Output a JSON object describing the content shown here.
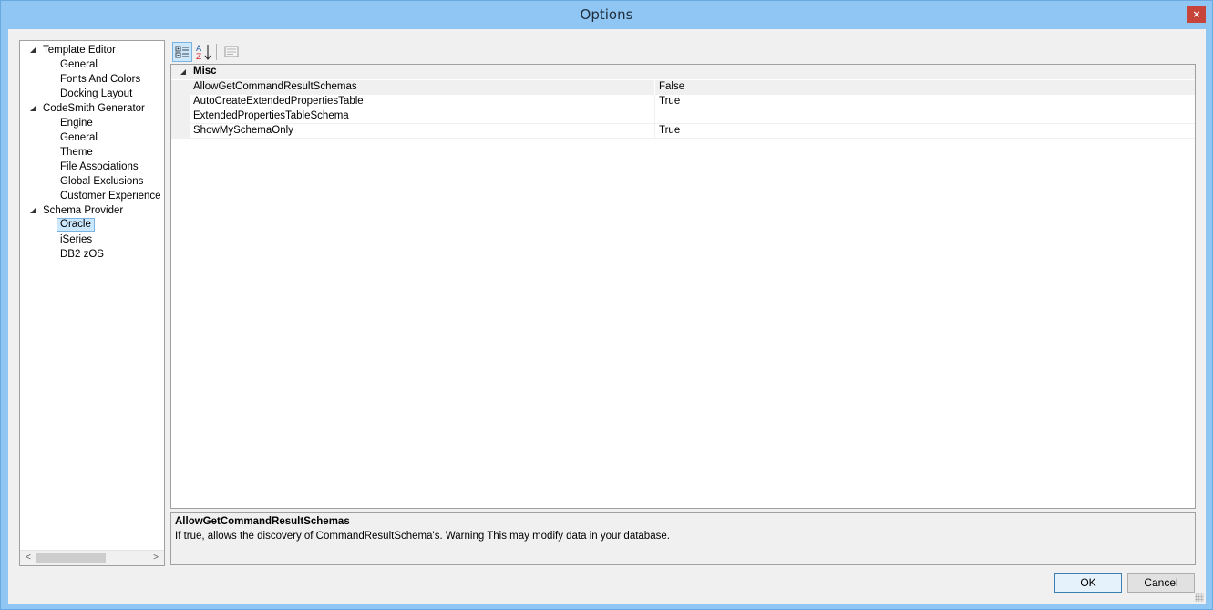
{
  "window": {
    "title": "Options",
    "close_glyph": "×"
  },
  "tree": {
    "items": [
      {
        "label": "Template Editor",
        "level": 0
      },
      {
        "label": "General",
        "level": 1
      },
      {
        "label": "Fonts And Colors",
        "level": 1
      },
      {
        "label": "Docking Layout",
        "level": 1
      },
      {
        "label": "CodeSmith Generator",
        "level": 0
      },
      {
        "label": "Engine",
        "level": 1
      },
      {
        "label": "General",
        "level": 1
      },
      {
        "label": "Theme",
        "level": 1
      },
      {
        "label": "File Associations",
        "level": 1
      },
      {
        "label": "Global Exclusions",
        "level": 1
      },
      {
        "label": "Customer Experience Im",
        "level": 1
      },
      {
        "label": "Schema Provider",
        "level": 0
      },
      {
        "label": "Oracle",
        "level": 1,
        "selected": true
      },
      {
        "label": "iSeries",
        "level": 1
      },
      {
        "label": "DB2 zOS",
        "level": 1
      }
    ],
    "scroll_left": "<",
    "scroll_right": ">"
  },
  "grid": {
    "category": "Misc",
    "properties": [
      {
        "name": "AllowGetCommandResultSchemas",
        "value": "False",
        "selected": true
      },
      {
        "name": "AutoCreateExtendedPropertiesTable",
        "value": "True"
      },
      {
        "name": "ExtendedPropertiesTableSchema",
        "value": ""
      },
      {
        "name": "ShowMySchemaOnly",
        "value": "True"
      }
    ]
  },
  "description": {
    "title": "AllowGetCommandResultSchemas",
    "text": "If true, allows the discovery of CommandResultSchema's. Warning This may modify data in your database."
  },
  "buttons": {
    "ok": "OK",
    "cancel": "Cancel"
  },
  "colors": {
    "title_bar": "#90c6f3",
    "close": "#c7443b",
    "selection": "#cce8ff"
  }
}
